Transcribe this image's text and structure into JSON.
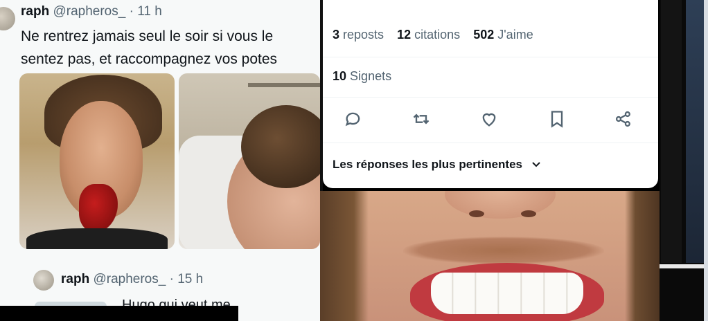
{
  "left_tweet": {
    "author_name": "raph",
    "author_handle": "@rapheros_",
    "separator": "·",
    "time": "11 h",
    "text": "Ne rentrez jamais seul le soir si vous le sentez pas, et raccompagnez vos potes",
    "reply": {
      "author_name": "raph",
      "author_handle": "@rapheros_",
      "separator": "·",
      "time": "15 h",
      "text": "Hugo qui veut me"
    }
  },
  "right_tweet": {
    "stats": [
      {
        "count": "3",
        "label": "reposts"
      },
      {
        "count": "12",
        "label": "citations"
      },
      {
        "count": "502",
        "label": "J'aime"
      }
    ],
    "bookmarks": {
      "count": "10",
      "label": "Signets"
    },
    "actions": [
      "reply-icon",
      "repost-icon",
      "like-icon",
      "bookmark-icon",
      "share-icon"
    ],
    "sort_label": "Les réponses les plus pertinentes",
    "sort_icon": "chevron-down-icon"
  },
  "colors": {
    "text_primary": "#0f1419",
    "text_secondary": "#536471",
    "card_bg": "#ffffff",
    "blood": "#c51d1d"
  }
}
